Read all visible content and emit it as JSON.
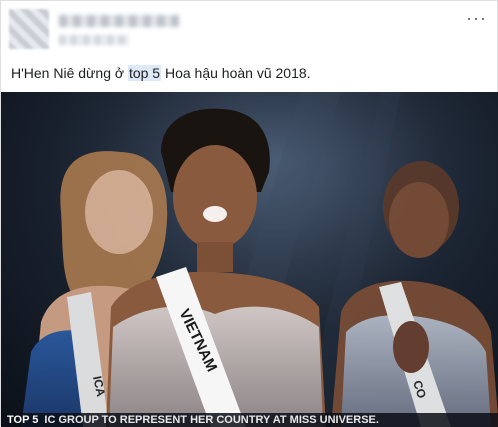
{
  "post": {
    "more_label": "···",
    "caption_pre": "H'Hen Niê dừng ở ",
    "caption_highlight": "top 5",
    "caption_post": " Hoa hậu hoàn vũ 2018.",
    "photo": {
      "sash_center": "VIETNAM",
      "sash_left": "ICA",
      "sash_right": "CO",
      "ticker_tag": "TOP 5",
      "ticker_text": "IC GROUP TO REPRESENT HER COUNTRY AT MISS UNIVERSE."
    }
  }
}
